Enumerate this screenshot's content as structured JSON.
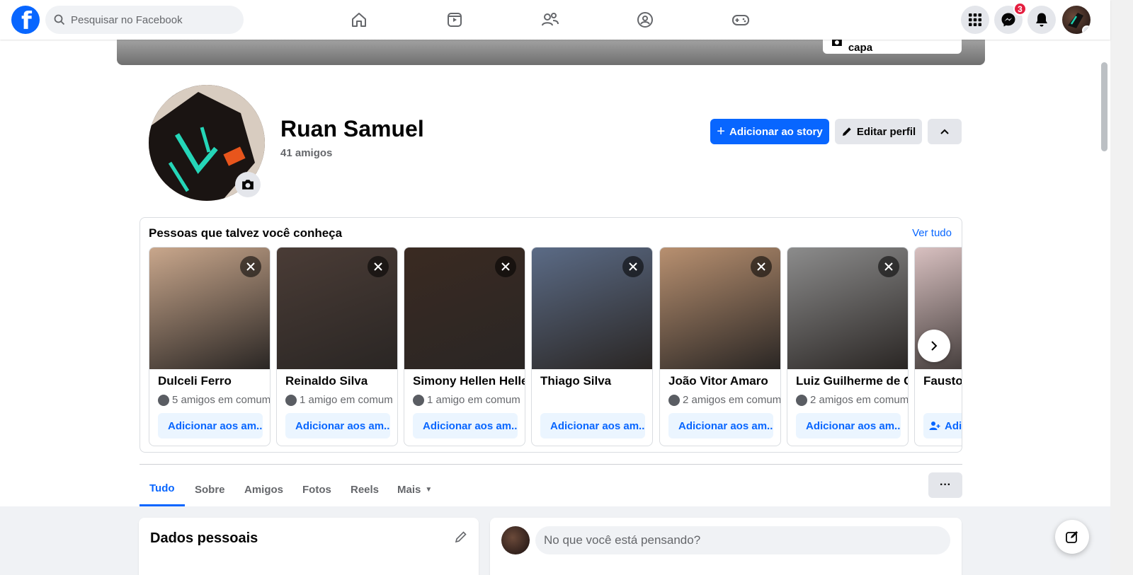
{
  "search": {
    "placeholder": "Pesquisar no Facebook"
  },
  "nav": {
    "tabs": [
      {
        "icon": "home-icon"
      },
      {
        "icon": "video-icon"
      },
      {
        "icon": "friends-icon"
      },
      {
        "icon": "groups-icon"
      },
      {
        "icon": "gaming-icon"
      }
    ]
  },
  "header_right": {
    "messenger_badge": "3"
  },
  "cover": {
    "add_cover_label": "Adicionar foto da capa"
  },
  "profile": {
    "name": "Ruan Samuel",
    "friends": "41 amigos",
    "add_story_label": "Adicionar ao story",
    "edit_profile_label": "Editar perfil"
  },
  "suggestions": {
    "title": "Pessoas que talvez você conheça",
    "see_all": "Ver tudo",
    "cards": [
      {
        "name": "Dulceli Ferro",
        "mutual": "5 amigos em comum",
        "add": "Adicionar aos am...",
        "photo": "#c9a78c"
      },
      {
        "name": "Reinaldo Silva",
        "mutual": "1 amigo em comum",
        "add": "Adicionar aos am...",
        "photo": "#4a3c36"
      },
      {
        "name": "Simony Hellen Helle",
        "mutual": "1 amigo em comum",
        "add": "Adicionar aos am...",
        "photo": "#3a2a22"
      },
      {
        "name": "Thiago Silva",
        "mutual": "",
        "add": "Adicionar aos am...",
        "photo": "#5b6b86"
      },
      {
        "name": "João Vitor Amaro",
        "mutual": "2 amigos em comum",
        "add": "Adicionar aos am...",
        "photo": "#b89070"
      },
      {
        "name": "Luiz Guilherme de C",
        "mutual": "2 amigos em comum",
        "add": "Adicionar aos am...",
        "photo": "#8c8c8c"
      },
      {
        "name": "Fausto",
        "mutual": "",
        "add": "Adicio",
        "photo": "#d8c0c0"
      }
    ]
  },
  "profile_tabs": [
    "Tudo",
    "Sobre",
    "Amigos",
    "Fotos",
    "Reels",
    "Mais"
  ],
  "intro": {
    "title": "Dados pessoais"
  },
  "composer": {
    "placeholder": "No que você está pensando?"
  },
  "colors": {
    "accent": "#0866ff",
    "badge": "#e41e3f"
  }
}
